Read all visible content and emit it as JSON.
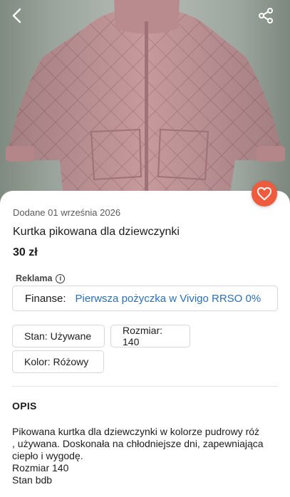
{
  "colors": {
    "accent": "#ef5b3d",
    "link": "#2b6fb6",
    "jacket": "#c79a9d"
  },
  "header": {
    "back_icon": "chevron-left-icon",
    "share_icon": "share-icon"
  },
  "listing": {
    "favorite_icon": "heart-icon",
    "date": "Dodane 01 września 2026",
    "title": "Kurtka pikowana dla dziewczynki",
    "price": "30 zł"
  },
  "ad": {
    "label": "Reklama",
    "key": "Finanse:",
    "value": "Pierwsza pożyczka w Vivigo RRSO 0%"
  },
  "attributes": [
    {
      "label": "Stan: Używane"
    },
    {
      "label": "Rozmiar: 140"
    },
    {
      "label": "Kolor: Różowy"
    }
  ],
  "description": {
    "heading": "OPIS",
    "lines": [
      "Pikowana kurtka dla dziewczynki w kolorze pudrowy róż",
      ", używana. Doskonała na chłodniejsze dni, zapewniająca",
      "ciepło i wygodę.",
      "Rozmiar 140",
      "Stan bdb"
    ]
  }
}
